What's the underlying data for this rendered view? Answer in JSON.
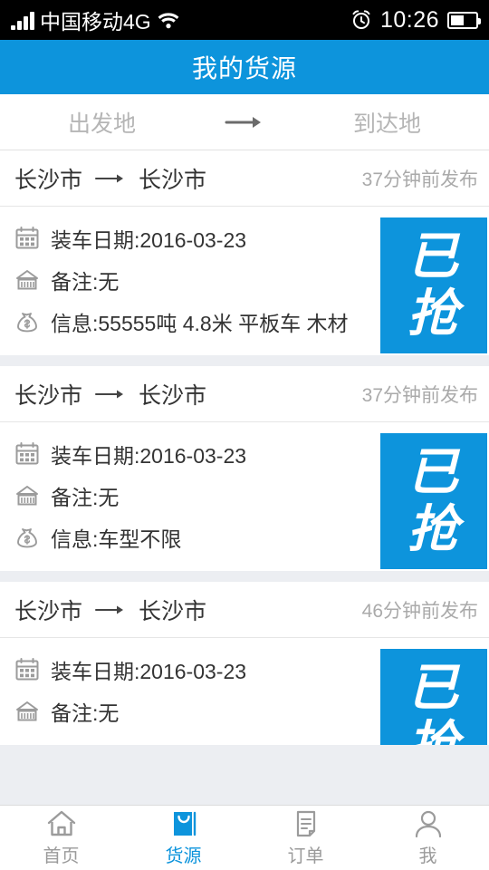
{
  "statusbar": {
    "carrier": "中国移动4G",
    "time": "10:26",
    "signal_icon": "signal-bars-icon",
    "wifi_icon": "wifi-icon",
    "alarm_icon": "alarm-clock-icon",
    "battery_icon": "battery-icon"
  },
  "header": {
    "title": "我的货源"
  },
  "filter": {
    "origin_placeholder": "出发地",
    "destination_placeholder": "到达地",
    "arrow_icon": "arrow-right-icon"
  },
  "colors": {
    "accent": "#0d94dc",
    "page_bg": "#eceef2",
    "muted_text": "#aaaaaa"
  },
  "cards": [
    {
      "origin": "长沙市",
      "destination": "长沙市",
      "posted": "37分钟前发布",
      "rows": [
        {
          "icon": "calendar-icon",
          "text": "装车日期:2016-03-23"
        },
        {
          "icon": "container-icon",
          "text": "备注:无"
        },
        {
          "icon": "money-bag-icon",
          "text": "信息:55555吨  4.8米 平板车  木材"
        }
      ],
      "badge": {
        "line1": "已",
        "line2": "抢"
      }
    },
    {
      "origin": "长沙市",
      "destination": "长沙市",
      "posted": "37分钟前发布",
      "rows": [
        {
          "icon": "calendar-icon",
          "text": "装车日期:2016-03-23"
        },
        {
          "icon": "container-icon",
          "text": "备注:无"
        },
        {
          "icon": "money-bag-icon",
          "text": "信息:车型不限"
        }
      ],
      "badge": {
        "line1": "已",
        "line2": "抢"
      }
    },
    {
      "origin": "长沙市",
      "destination": "长沙市",
      "posted": "46分钟前发布",
      "rows": [
        {
          "icon": "calendar-icon",
          "text": "装车日期:2016-03-23"
        },
        {
          "icon": "container-icon",
          "text": "备注:无"
        }
      ],
      "badge": {
        "line1": "已",
        "line2": "抢"
      }
    }
  ],
  "tabbar": {
    "items": [
      {
        "label": "首页",
        "icon": "home-icon",
        "active": false
      },
      {
        "label": "货源",
        "icon": "bag-icon",
        "active": true
      },
      {
        "label": "订单",
        "icon": "document-icon",
        "active": false
      },
      {
        "label": "我",
        "icon": "person-icon",
        "active": false
      }
    ]
  }
}
